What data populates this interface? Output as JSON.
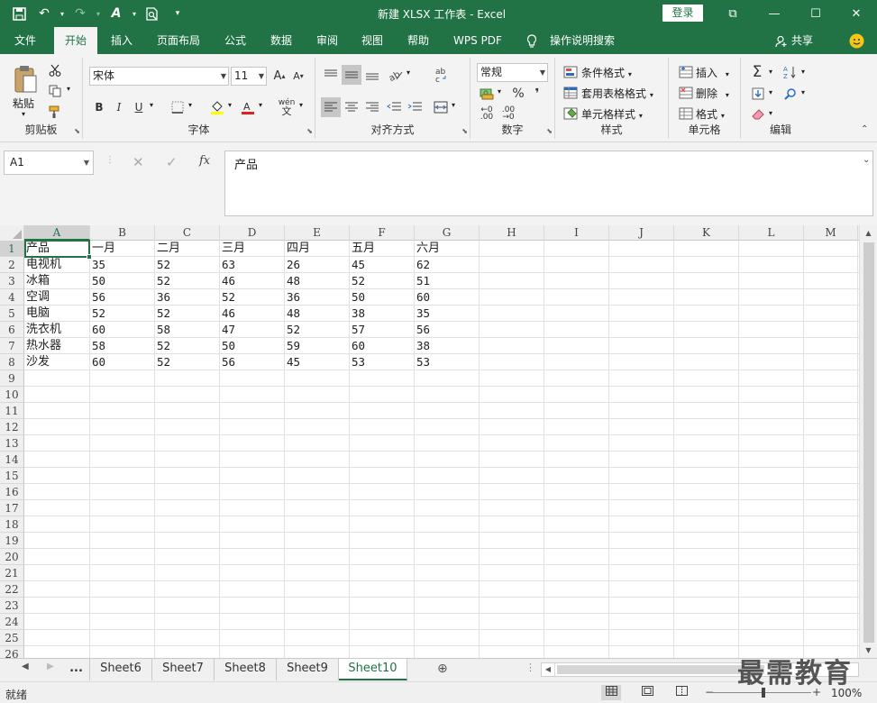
{
  "window": {
    "title": "新建 XLSX 工作表 - Excel",
    "login_label": "登录",
    "min_glyph": "—",
    "max_glyph": "☐",
    "close_glyph": "✕",
    "restore_glyph": "⧉"
  },
  "qat": {
    "save_glyph": "💾",
    "undo_glyph": "↶",
    "redo_glyph": "↷",
    "touch_glyph": "A",
    "preview_glyph": "🔍",
    "more_glyph": "▾"
  },
  "ribbon_tabs": [
    "文件",
    "开始",
    "插入",
    "页面布局",
    "公式",
    "数据",
    "审阅",
    "视图",
    "帮助",
    "WPS PDF"
  ],
  "tell_me": "操作说明搜索",
  "share": "共享",
  "clipboard": {
    "paste": "粘贴",
    "label": "剪贴板"
  },
  "font": {
    "name": "宋体",
    "size": "11",
    "bold": "B",
    "italic": "I",
    "underline": "U",
    "grow": "A",
    "shrink": "A",
    "phonetic": "wén",
    "label": "字体"
  },
  "alignment": {
    "label": "对齐方式"
  },
  "number": {
    "format": "常规",
    "percent": "%",
    "comma": "❜",
    "inc_decimal": ".00",
    "dec_decimal": ".00",
    "label": "数字"
  },
  "styles": {
    "conditional": "条件格式",
    "table": "套用表格格式",
    "cell": "单元格样式",
    "label": "样式"
  },
  "cells_group": {
    "insert": "插入",
    "delete": "删除",
    "format": "格式",
    "label": "单元格"
  },
  "editing": {
    "sum": "Σ",
    "label": "编辑"
  },
  "formula_bar": {
    "name_box": "A1",
    "cancel": "✕",
    "enter": "✓",
    "fx": "fx",
    "content": "产品"
  },
  "columns": [
    "A",
    "B",
    "C",
    "D",
    "E",
    "F",
    "G",
    "H",
    "I",
    "J",
    "K",
    "L",
    "M"
  ],
  "rows": [
    "1",
    "2",
    "3",
    "4",
    "5",
    "6",
    "7",
    "8",
    "9",
    "10",
    "11",
    "12",
    "13",
    "14",
    "15",
    "16",
    "17",
    "18",
    "19",
    "20",
    "21",
    "22",
    "23",
    "24",
    "25",
    "26"
  ],
  "table": [
    [
      "产品",
      "一月",
      "二月",
      "三月",
      "四月",
      "五月",
      "六月"
    ],
    [
      "电视机",
      "35",
      "52",
      "63",
      "26",
      "45",
      "62"
    ],
    [
      "冰箱",
      "50",
      "52",
      "46",
      "48",
      "52",
      "51"
    ],
    [
      "空调",
      "56",
      "36",
      "52",
      "36",
      "50",
      "60"
    ],
    [
      "电脑",
      "52",
      "52",
      "46",
      "48",
      "38",
      "35"
    ],
    [
      "洗衣机",
      "60",
      "58",
      "47",
      "52",
      "57",
      "56"
    ],
    [
      "热水器",
      "58",
      "52",
      "50",
      "59",
      "60",
      "38"
    ],
    [
      "沙发",
      "60",
      "52",
      "56",
      "45",
      "53",
      "53"
    ]
  ],
  "sheets": [
    "Sheet6",
    "Sheet7",
    "Sheet8",
    "Sheet9",
    "Sheet10"
  ],
  "active_sheet": "Sheet10",
  "sheet_more": "...",
  "status": {
    "ready": "就绪",
    "zoom": "100%",
    "zoom_minus": "−",
    "zoom_plus": "+"
  },
  "watermark": "最需教育",
  "colors": {
    "accent": "#217346"
  }
}
